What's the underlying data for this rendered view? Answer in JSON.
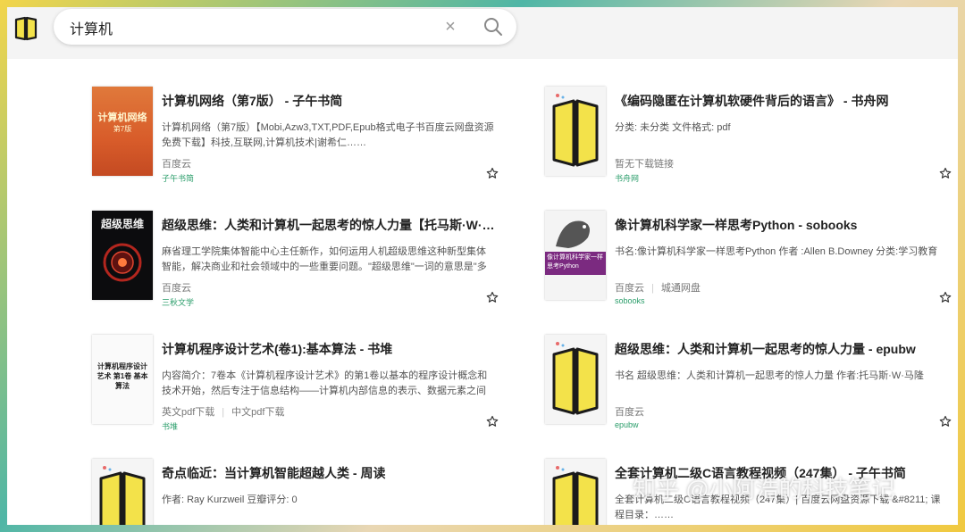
{
  "search": {
    "value": "计算机",
    "clear_label": "×"
  },
  "results": [
    {
      "title": "计算机网络（第7版） - 子午书简",
      "desc": "计算机网络（第7版）【Mobi,Azw3,TXT,PDF,Epub格式电子书百度云网盘资源免费下载】科技,互联网,计算机技术|谢希仁……",
      "meta": [
        "百度云"
      ],
      "source": "子午书简",
      "cover": {
        "type": "red",
        "title": "计算机网络",
        "subtitle": "第7版"
      }
    },
    {
      "title": "《编码隐匿在计算机软硬件背后的语言》 - 书舟网",
      "desc": "分类: 未分类 文件格式: pdf",
      "meta": [
        "暂无下载链接"
      ],
      "source": "书舟网",
      "cover": {
        "type": "placeholder"
      }
    },
    {
      "title": "超级思维：人类和计算机一起思考的惊人力量【托马斯·W·马...",
      "desc": "麻省理工学院集体智能中心主任新作，如何运用人机超级思维这种新型集体智能，解决商业和社会领域中的一些重要问题。\"超级思维\"一词的意思是\"多种...",
      "meta": [
        "百度云"
      ],
      "source": "三秋文学",
      "cover": {
        "type": "dark",
        "title": "超级思维"
      }
    },
    {
      "title": "像计算机科学家一样思考Python - sobooks",
      "desc": "书名:像计算机科学家一样思考Python 作者 :Allen B.Downey 分类:学习教育",
      "meta": [
        "百度云",
        "城通网盘"
      ],
      "source": "sobooks",
      "cover": {
        "type": "python",
        "title": "像计算机科学家一样思考Python"
      }
    },
    {
      "title": "计算机程序设计艺术(卷1):基本算法 - 书堆",
      "desc": "内容简介：7卷本《计算机程序设计艺术》的第1卷以基本的程序设计概念和技术开始，然后专注于信息结构——计算机内部信息的表示、数据元素之间的...",
      "meta": [
        "英文pdf下载",
        "中文pdf下载"
      ],
      "source": "书堆",
      "cover": {
        "type": "white",
        "title": "计算机程序设计艺术 第1卷 基本算法"
      }
    },
    {
      "title": "超级思维：人类和计算机一起思考的惊人力量 - epubw",
      "desc": "书名 超级思维：人类和计算机一起思考的惊人力量 作者:托马斯·W·马隆",
      "meta": [
        "百度云"
      ],
      "source": "epubw",
      "cover": {
        "type": "placeholder"
      }
    },
    {
      "title": "奇点临近：当计算机智能超越人类 - 周读",
      "desc": "作者: Ray Kurzweil 豆瓣评分: 0",
      "meta": [],
      "source": "",
      "cover": {
        "type": "placeholder"
      }
    },
    {
      "title": "全套计算机二级C语言教程视频（247集） - 子午书简",
      "desc": "全套计算机二级C语言教程视频（247集）| 百度云网盘资源下载 &#8211; 课程目录：……",
      "meta": [],
      "source": "",
      "cover": {
        "type": "placeholder"
      }
    }
  ],
  "watermark": "知乎 @小阿浩的科技笔记",
  "colors": {
    "source": "#2a9d6a",
    "logo_yellow": "#f3e24a"
  }
}
